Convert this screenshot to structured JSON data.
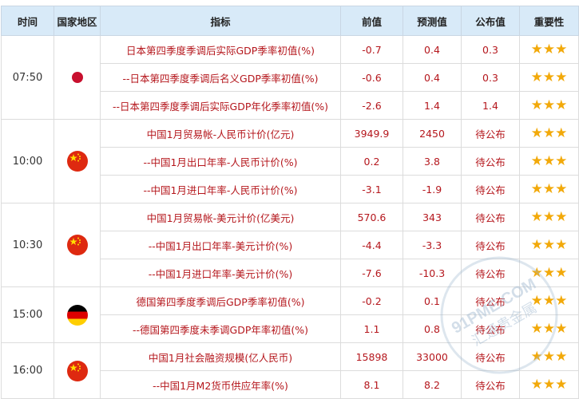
{
  "headers": [
    "时间",
    "国家地区",
    "指标",
    "前值",
    "预测值",
    "公布值",
    "重要性"
  ],
  "groups": [
    {
      "time": "07:50",
      "flag": "jp",
      "rows": [
        {
          "indicator": "日本第四季度季调后实际GDP季率初值(%)",
          "prev": "-0.7",
          "forecast": "0.4",
          "actual": "0.3",
          "stars": "★★★"
        },
        {
          "indicator": "--日本第四季度季调后名义GDP季率初值(%)",
          "prev": "-0.6",
          "forecast": "0.4",
          "actual": "0.3",
          "stars": "★★★"
        },
        {
          "indicator": "--日本第四季度季调后实际GDP年化季率初值(%)",
          "prev": "-2.6",
          "forecast": "1.4",
          "actual": "1.4",
          "stars": "★★★"
        }
      ]
    },
    {
      "time": "10:00",
      "flag": "cn",
      "rows": [
        {
          "indicator": "中国1月贸易帐-人民币计价(亿元)",
          "prev": "3949.9",
          "forecast": "2450",
          "actual": "待公布",
          "stars": "★★★"
        },
        {
          "indicator": "--中国1月出口年率-人民币计价(%)",
          "prev": "0.2",
          "forecast": "3.8",
          "actual": "待公布",
          "stars": "★★★"
        },
        {
          "indicator": "--中国1月进口年率-人民币计价(%)",
          "prev": "-3.1",
          "forecast": "-1.9",
          "actual": "待公布",
          "stars": "★★★"
        }
      ]
    },
    {
      "time": "10:30",
      "flag": "cn",
      "rows": [
        {
          "indicator": "中国1月贸易帐-美元计价(亿美元)",
          "prev": "570.6",
          "forecast": "343",
          "actual": "待公布",
          "stars": "★★★"
        },
        {
          "indicator": "--中国1月出口年率-美元计价(%)",
          "prev": "-4.4",
          "forecast": "-3.3",
          "actual": "待公布",
          "stars": "★★★"
        },
        {
          "indicator": "--中国1月进口年率-美元计价(%)",
          "prev": "-7.6",
          "forecast": "-10.3",
          "actual": "待公布",
          "stars": "★★★"
        }
      ]
    },
    {
      "time": "15:00",
      "flag": "de",
      "rows": [
        {
          "indicator": "德国第四季度季调后GDP季率初值(%)",
          "prev": "-0.2",
          "forecast": "0.1",
          "actual": "待公布",
          "stars": "★★★"
        },
        {
          "indicator": "--德国第四季度未季调GDP年率初值(%)",
          "prev": "1.1",
          "forecast": "0.8",
          "actual": "待公布",
          "stars": "★★★"
        }
      ]
    },
    {
      "time": "16:00",
      "flag": "cn",
      "rows": [
        {
          "indicator": "中国1月社会融资规模(亿人民币)",
          "prev": "15898",
          "forecast": "33000",
          "actual": "待公布",
          "stars": "★★★"
        },
        {
          "indicator": "--中国1月M2货币供应年率(%)",
          "prev": "8.1",
          "forecast": "8.2",
          "actual": "待公布",
          "stars": "★★★"
        }
      ]
    }
  ],
  "watermark": {
    "line1": "91PME.COM",
    "line2": "汇通贵金属"
  },
  "colors": {
    "header_bg": "#d8eaf8",
    "indicator_text": "#b5171d",
    "star": "#f2a90a"
  }
}
